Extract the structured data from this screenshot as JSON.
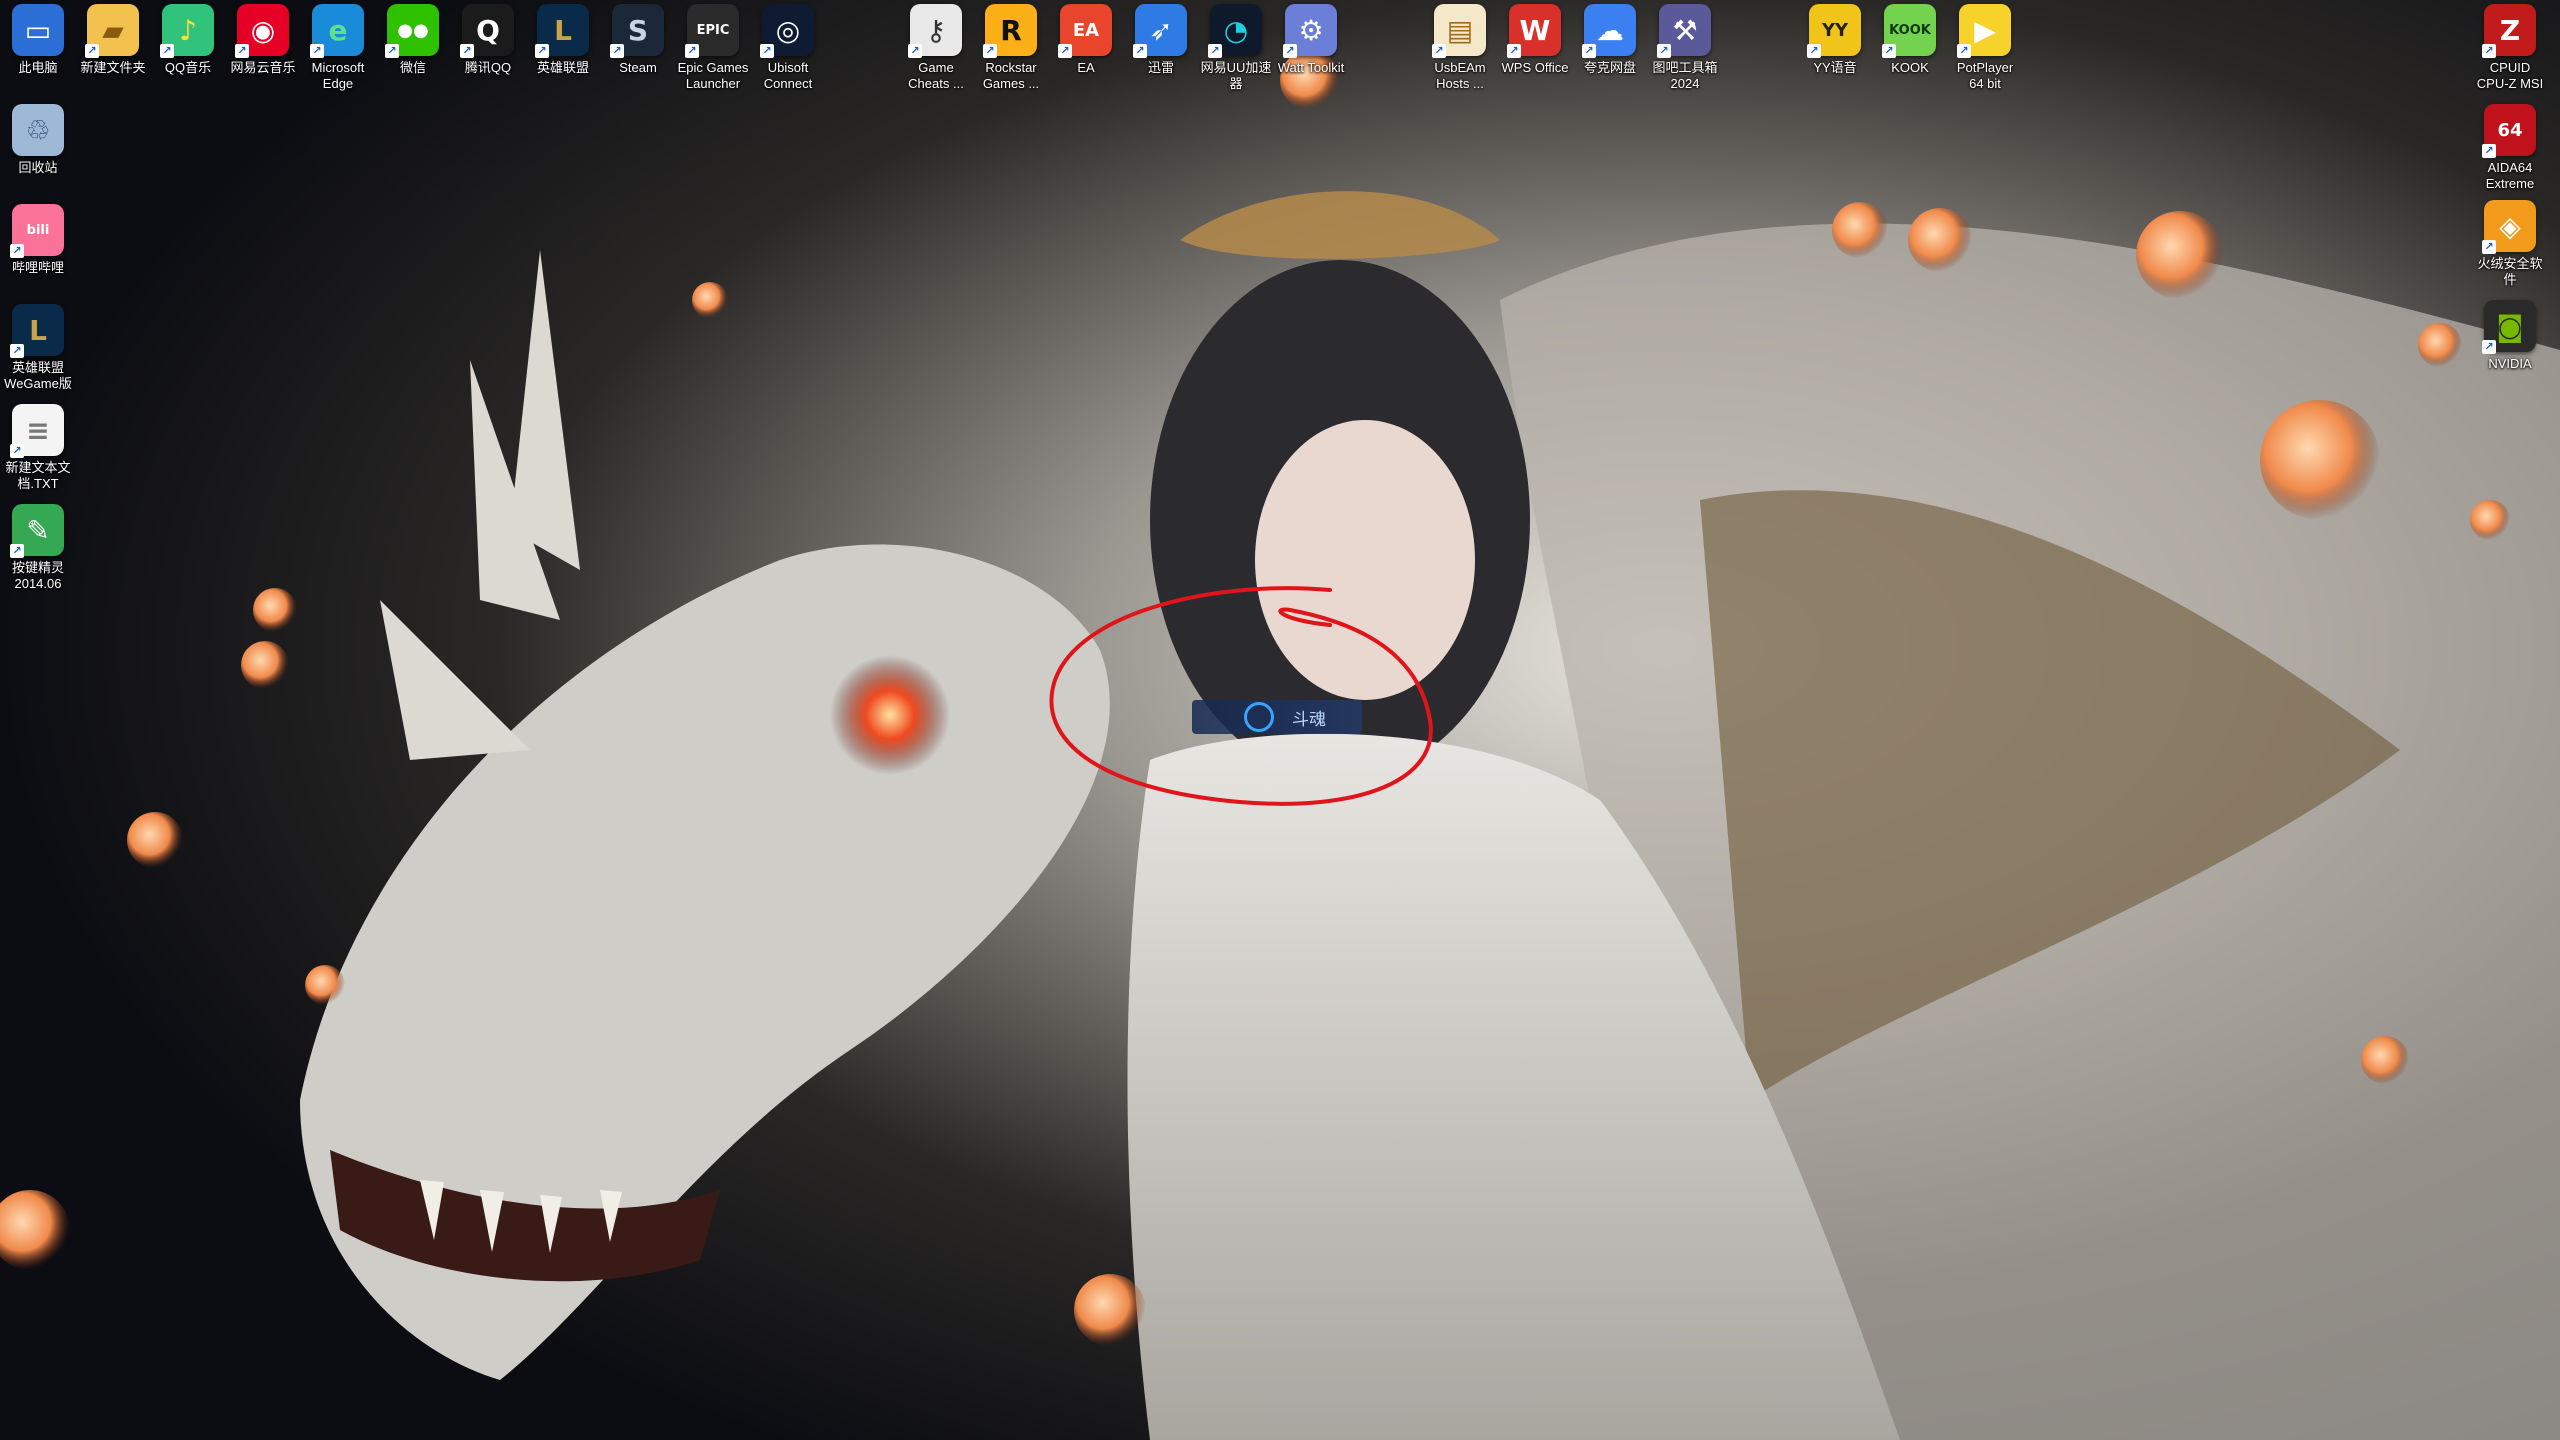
{
  "desktop": {
    "colors": {
      "background": "#0c0d12",
      "annotation": "#e0151b"
    },
    "overlay": {
      "label": "斗魂"
    },
    "icons": [
      {
        "id": "computer",
        "label": "此电脑",
        "icon": "computer-icon",
        "glyph": "▭",
        "bg": "#2b6fd6",
        "fg": "#ffffff"
      },
      {
        "id": "new-folder",
        "label": "新建文件夹",
        "icon": "folder-icon",
        "glyph": "▰",
        "bg": "#f2c14e",
        "fg": "#8a5a10"
      },
      {
        "id": "qq-music",
        "label": "QQ音乐",
        "icon": "qq-music-icon",
        "glyph": "♪",
        "bg": "#31c27c",
        "fg": "#ffe033"
      },
      {
        "id": "netease-music",
        "label": "网易云音乐",
        "icon": "netease-music-icon",
        "glyph": "◉",
        "bg": "#e60026",
        "fg": "#ffffff"
      },
      {
        "id": "edge",
        "label": "Microsoft\nEdge",
        "icon": "edge-icon",
        "glyph": "e",
        "bg": "#1a8bd8",
        "fg": "#5fe08a"
      },
      {
        "id": "wechat",
        "label": "微信",
        "icon": "wechat-icon",
        "glyph": "●●",
        "bg": "#2dc100",
        "fg": "#ffffff"
      },
      {
        "id": "tencent-qq",
        "label": "腾讯QQ",
        "icon": "qq-penguin-icon",
        "glyph": "Q",
        "bg": "#1b1b1b",
        "fg": "#ffffff"
      },
      {
        "id": "lol",
        "label": "英雄联盟",
        "icon": "league-of-legends-icon",
        "glyph": "L",
        "bg": "#0a2a4a",
        "fg": "#c9a34c"
      },
      {
        "id": "steam",
        "label": "Steam",
        "icon": "steam-icon",
        "glyph": "S",
        "bg": "#1b2838",
        "fg": "#c7d5e0"
      },
      {
        "id": "epic",
        "label": "Epic Games\nLauncher",
        "icon": "epic-games-icon",
        "glyph": "EPIC",
        "bg": "#2a2a2a",
        "fg": "#ffffff"
      },
      {
        "id": "ubisoft",
        "label": "Ubisoft\nConnect",
        "icon": "ubisoft-icon",
        "glyph": "◎",
        "bg": "#0f1a33",
        "fg": "#ffffff"
      },
      {
        "id": "game-cheats",
        "label": "Game\nCheats ...",
        "icon": "key-icon",
        "glyph": "⚷",
        "bg": "#e8e8e8",
        "fg": "#333333"
      },
      {
        "id": "rockstar",
        "label": "Rockstar\nGames ...",
        "icon": "rockstar-icon",
        "glyph": "R",
        "bg": "#fcaf17",
        "fg": "#111111"
      },
      {
        "id": "ea",
        "label": "EA",
        "icon": "ea-icon",
        "glyph": "EA",
        "bg": "#e8452c",
        "fg": "#ffffff"
      },
      {
        "id": "xunlei",
        "label": "迅雷",
        "icon": "xunlei-bird-icon",
        "glyph": "➶",
        "bg": "#2f7be5",
        "fg": "#ffffff"
      },
      {
        "id": "uu",
        "label": "网易UU加速\n器",
        "icon": "uu-accelerator-icon",
        "glyph": "◔",
        "bg": "#0e1a2b",
        "fg": "#1fd1e0"
      },
      {
        "id": "watt",
        "label": "Watt Toolkit",
        "icon": "watt-toolkit-icon",
        "glyph": "⚙",
        "bg": "#6c7fd8",
        "fg": "#ffffff"
      },
      {
        "id": "usbeam",
        "label": "UsbEAm\nHosts ...",
        "icon": "document-icon",
        "glyph": "▤",
        "bg": "#f5e8c8",
        "fg": "#a06b1a"
      },
      {
        "id": "wps",
        "label": "WPS Office",
        "icon": "wps-office-icon",
        "glyph": "W",
        "bg": "#d9302c",
        "fg": "#ffffff"
      },
      {
        "id": "cloud",
        "label": "夸克网盘",
        "icon": "cloud-drive-icon",
        "glyph": "☁",
        "bg": "#3b7ff0",
        "fg": "#ffffff"
      },
      {
        "id": "tools",
        "label": "图吧工具箱\n2024",
        "icon": "toolbox-icon",
        "glyph": "⚒",
        "bg": "#5a5a9a",
        "fg": "#ffffff"
      },
      {
        "id": "yy",
        "label": "YY语音",
        "icon": "yy-voice-icon",
        "glyph": "YY",
        "bg": "#f0c419",
        "fg": "#222222"
      },
      {
        "id": "kook",
        "label": "KOOK",
        "icon": "kook-icon",
        "glyph": "KOOK",
        "bg": "#74d34e",
        "fg": "#0c3a0c"
      },
      {
        "id": "potplayer",
        "label": "PotPlayer\n64 bit",
        "icon": "potplayer-icon",
        "glyph": "▶",
        "bg": "#f7d22a",
        "fg": "#ffffff"
      },
      {
        "id": "recycle-bin",
        "label": "回收站",
        "icon": "recycle-bin-icon",
        "glyph": "♲",
        "bg": "#9fb8d6",
        "fg": "#2b4f7a"
      },
      {
        "id": "bilibili",
        "label": "哔哩哔哩",
        "icon": "bilibili-icon",
        "glyph": "bili",
        "bg": "#fb7299",
        "fg": "#ffffff"
      },
      {
        "id": "lol-wegame",
        "label": "英雄联盟\nWeGame版",
        "icon": "league-of-legends-icon",
        "glyph": "L",
        "bg": "#0a2a4a",
        "fg": "#c9a34c"
      },
      {
        "id": "new-text",
        "label": "新建文本文\n档.TXT",
        "icon": "text-file-icon",
        "glyph": "≡",
        "bg": "#f4f4f4",
        "fg": "#777777"
      },
      {
        "id": "keywizard",
        "label": "按键精灵\n2014.06",
        "icon": "key-wizard-icon",
        "glyph": "✎",
        "bg": "#35a853",
        "fg": "#ffffff"
      },
      {
        "id": "cpuid",
        "label": "CPUID\nCPU-Z MSI",
        "icon": "cpu-z-icon",
        "glyph": "Z",
        "bg": "#c21b1b",
        "fg": "#ffffff"
      },
      {
        "id": "aida64",
        "label": "AIDA64\nExtreme",
        "icon": "aida64-icon",
        "glyph": "64",
        "bg": "#c0121c",
        "fg": "#ffffff"
      },
      {
        "id": "huorong",
        "label": "火绒安全软\n件",
        "icon": "huorong-icon",
        "glyph": "◈",
        "bg": "#f29a1a",
        "fg": "#ffffff"
      },
      {
        "id": "nvidia",
        "label": "NVIDIA",
        "icon": "nvidia-icon",
        "glyph": "◙",
        "bg": "#2a2a2a",
        "fg": "#76b900"
      }
    ]
  }
}
